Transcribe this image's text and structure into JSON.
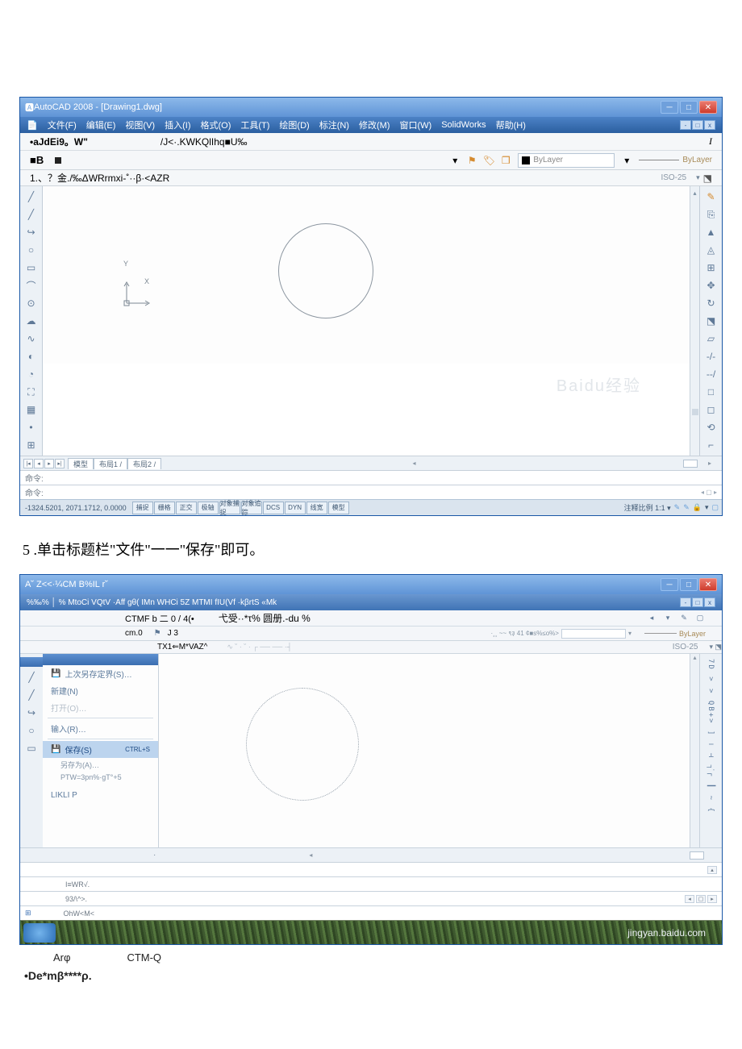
{
  "s1": {
    "title": "AutoCAD 2008 - [Drawing1.dwg]",
    "menu": [
      "文件(F)",
      "编辑(E)",
      "视图(V)",
      "插入(I)",
      "格式(O)",
      "工具(T)",
      "绘图(D)",
      "标注(N)",
      "修改(M)",
      "窗口(W)",
      "SolidWorks",
      "帮助(H)"
    ],
    "row1_left": "•aJdEi9。W\"",
    "row1_mid": "/J<·.KWKQlIhq■U‰",
    "row1_cursor": "I",
    "row2_label": "■B",
    "row2_layer": "ByLayer",
    "row2_linetype": "ByLayer",
    "row3_text": "1.、？金./‰ΔWRrmxi-˚··β·<AZR",
    "iso": "ISO-25",
    "ucs_x": "X",
    "ucs_y": "Y",
    "tabs": [
      "模型",
      "布局1",
      "布局2"
    ],
    "cmd1": "命令:",
    "cmd2": "命令:",
    "coords": "-1324.5201, 2071.1712, 0.0000",
    "status_btns": [
      "捕捉",
      "栅格",
      "正交",
      "极轴",
      "对象捕捉",
      "对象追踪",
      "DCS",
      "DYN",
      "线宽",
      "模型"
    ],
    "status_scale": "注释比例  1:1 ▾",
    "watermark": "Baidu经验"
  },
  "step5": "5 .单击标题栏\"文件\"一一\"保存\"即可。",
  "s2": {
    "title": "A˘ Z<<·¼CM B%IL r˘",
    "menu_text": "%‰% │ % MtoCi VQtV ·Aff gθ( IMn WHCi 5Z MTMI fIU(Vf ·kβrtS «Mk",
    "row1_c1": "CTMF b 二  0 / 4(•",
    "row1_c2": "弋受··*τ% 圆册.-du %",
    "row2_c1": "cm.0",
    "row2_c2": "J 3",
    "row2_lay": "·¸¸ ~~  ९३ 41 ¢■s%≤o%>",
    "row2_linetype": "ByLayer",
    "row3_text": "TX1⇐M*VAZ^",
    "row3_scribble": "∿  ˘ ·  ˘ · ┌ ── ── ·┤",
    "iso2": "ISO-25",
    "menu_items": {
      "recent": "上次另存定界(S)…",
      "new": "新建(N)",
      "open": "打开(O)…",
      "import": "输入(R)…",
      "save": "保存(S)",
      "save_key": "CTRL+S",
      "saveas": "另存为(A)…",
      "saveas_sub": "PTW=3pn%·gT°+5"
    },
    "free": "LIKLI P",
    "rbar": "7D > > QB+>   ] ।   ⊣ ┐᷾┌ ┃ ~  {",
    "tabline_dot": "·",
    "cmd_lines": [
      "I≡WR√.",
      "93/\\^>.",
      "OhW<M<"
    ],
    "bottom1": "Arφ",
    "bottom2": "CTM-Q",
    "final": "•De*mβ****ρ.",
    "taskbar_wm": "jingyan.baidu.com"
  }
}
